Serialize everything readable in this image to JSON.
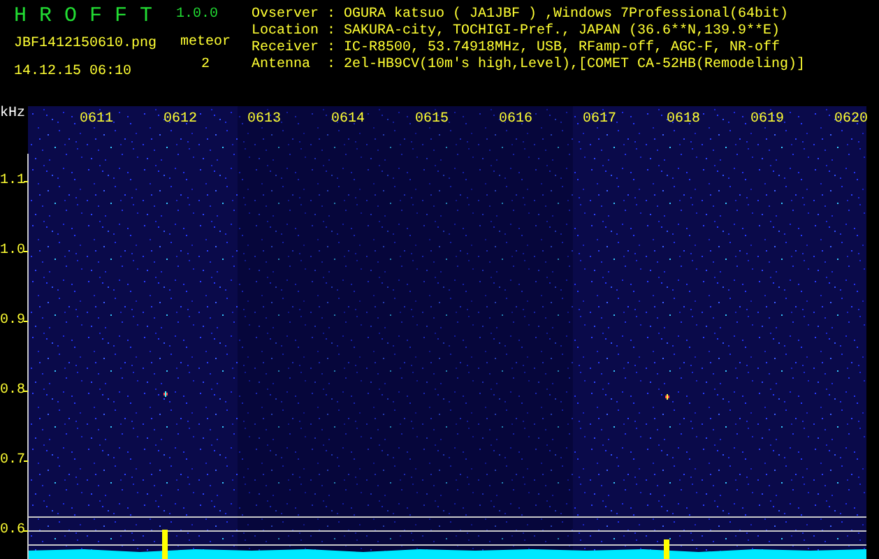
{
  "app": {
    "title": "H R O F F T",
    "version": "1.0.0"
  },
  "file": {
    "name": "JBF1412150610.png",
    "datetime": "14.12.15 06:10"
  },
  "meteor": {
    "label": "meteor",
    "count": "2"
  },
  "station_info": [
    {
      "label": "Ovserver",
      "separator": ":",
      "value": "OGURA katsuo ( JA1JBF ) ,Windows 7Professional(64bit)"
    },
    {
      "label": "Location",
      "separator": ":",
      "value": "SAKURA-city, TOCHIGI-Pref., JAPAN (36.6**N,139.9**E)"
    },
    {
      "label": "Receiver",
      "separator": ":",
      "value": "IC-R8500, 53.74918MHz, USB, RFamp-off, AGC-F, NR-off"
    },
    {
      "label": "Antenna",
      "separator": ":",
      "value": "2el-HB9CV(10m's high,Level),[COMET CA-52HB(Remodeling)]"
    }
  ],
  "spectrogram": {
    "unit": "kHz",
    "time_labels": [
      "0611",
      "0612",
      "0613",
      "0614",
      "0615",
      "0616",
      "0617",
      "0618",
      "0619",
      "0620"
    ],
    "frequency_labels": [
      "1.1",
      "1.0",
      "0.9",
      "0.8",
      "0.7",
      "0.6"
    ]
  }
}
